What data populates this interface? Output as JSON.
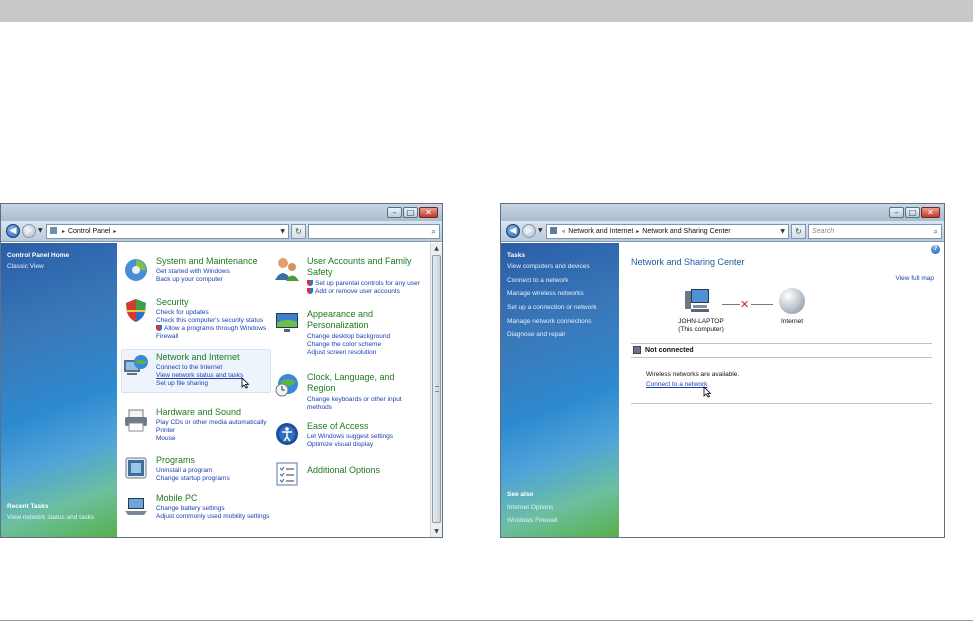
{
  "window1": {
    "address": {
      "root": "Control Panel"
    },
    "sidebar": {
      "items": [
        "Control Panel Home",
        "Classic View"
      ],
      "recent_tasks_header": "Recent Tasks",
      "recent_tasks": [
        "View network status and tasks"
      ]
    },
    "categories": [
      {
        "title": "System and Maintenance",
        "links": [
          "Get started with Windows",
          "Back up your computer"
        ],
        "icon": "system-maintenance-icon"
      },
      {
        "title": "Security",
        "links": [
          "Check for updates",
          "Check this computer's security status",
          "Allow a programs through Windows Firewall"
        ],
        "icon": "security-shield-icon"
      },
      {
        "title": "Network and Internet",
        "links": [
          "Connect to the Internet",
          "View network status and tasks",
          "Set up file sharing"
        ],
        "icon": "network-globe-icon"
      },
      {
        "title": "Hardware and Sound",
        "links": [
          "Play CDs or other media automatically",
          "Printer",
          "Mouse"
        ],
        "icon": "printer-icon"
      },
      {
        "title": "Programs",
        "links": [
          "Uninstall a program",
          "Change startup programs"
        ],
        "icon": "programs-icon"
      },
      {
        "title": "Mobile PC",
        "links": [
          "Change battery settings",
          "Adjust commonly used mobility settings"
        ],
        "icon": "laptop-icon"
      },
      {
        "title": "User Accounts and Family Safety",
        "links": [
          "Set up parental controls for any user",
          "Add or remove user accounts"
        ],
        "icon": "users-icon"
      },
      {
        "title": "Appearance and Personalization",
        "links": [
          "Change desktop background",
          "Change the color scheme",
          "Adjust screen resolution"
        ],
        "icon": "monitor-icon"
      },
      {
        "title": "Clock, Language, and Region",
        "links": [
          "Change keyboards or other input methods"
        ],
        "icon": "clock-globe-icon"
      },
      {
        "title": "Ease of Access",
        "links": [
          "Let Windows suggest settings",
          "Optimize visual display"
        ],
        "icon": "ease-access-icon"
      },
      {
        "title": "Additional Options",
        "links": [],
        "icon": "options-list-icon"
      }
    ]
  },
  "window2": {
    "address": {
      "parts": [
        "Network and Internet",
        "Network and Sharing Center"
      ]
    },
    "search_placeholder": "Search",
    "sidebar": {
      "tasks_header": "Tasks",
      "tasks": [
        "View computers and devices",
        "Connect to a network",
        "Manage wireless networks",
        "Set up a connection or network",
        "Manage network connections",
        "Diagnose and repair"
      ],
      "see_also_header": "See also",
      "see_also": [
        "Internet Options",
        "Windows Firewall"
      ]
    },
    "page_title": "Network and Sharing Center",
    "view_full_map": "View full map",
    "computer_name": "JOHN-LAPTOP",
    "computer_sub": "(This computer)",
    "internet_label": "Internet",
    "status": "Not connected",
    "wireless_msg": "Wireless networks are available.",
    "connect_link": "Connect to a network"
  },
  "colors": {
    "sidebar_blue": "#2e6eb4",
    "category_green": "#1e7a1e",
    "link_blue": "#1a3fb0",
    "error_red": "#d02020"
  }
}
